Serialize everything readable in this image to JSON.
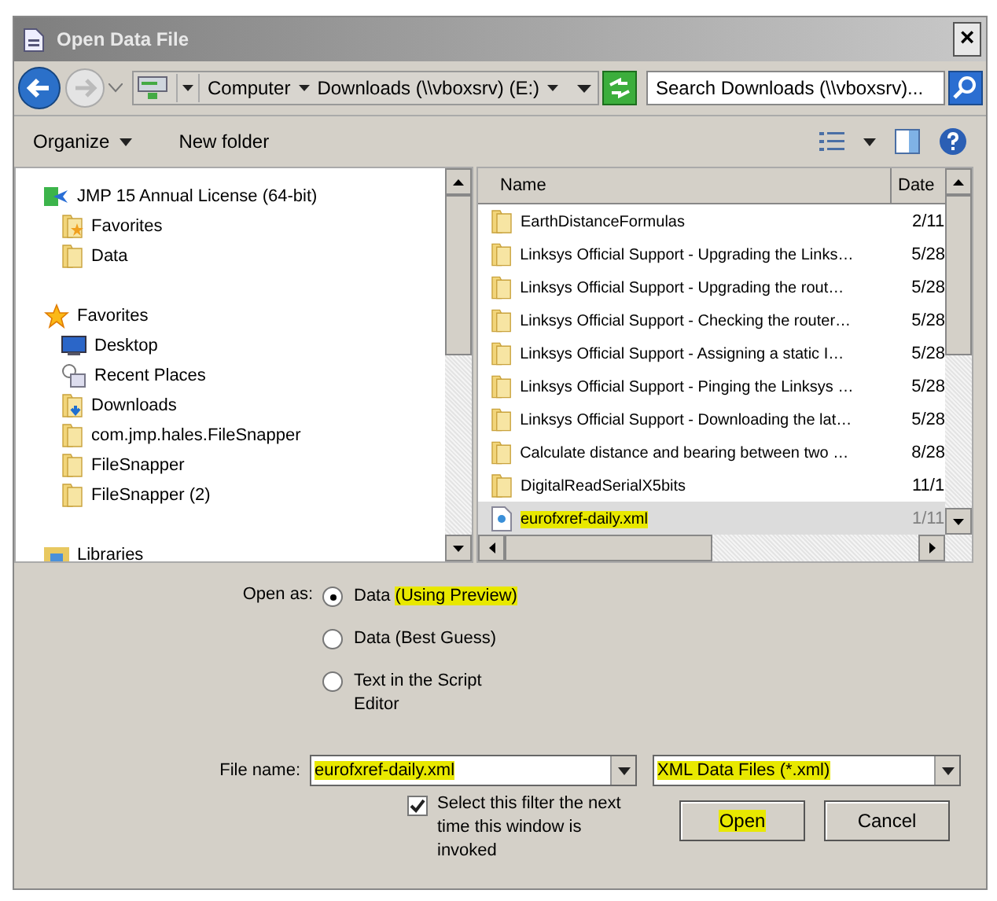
{
  "window": {
    "title": "Open Data File",
    "close": "×"
  },
  "address": {
    "crumbs": [
      "Computer",
      "Downloads (\\\\vboxsrv) (E:)"
    ]
  },
  "search": {
    "placeholder": "Search Downloads (\\\\vboxsrv)..."
  },
  "toolbar": {
    "organize": "Organize",
    "new_folder": "New folder"
  },
  "sidebar": {
    "items": [
      {
        "label": "JMP 15 Annual License (64-bit)",
        "kind": "app",
        "children": [
          {
            "label": "Favorites",
            "kind": "starfolder"
          },
          {
            "label": "Data",
            "kind": "folder"
          }
        ]
      },
      {
        "label": "Favorites",
        "kind": "star",
        "children": [
          {
            "label": "Desktop",
            "kind": "desktop"
          },
          {
            "label": "Recent Places",
            "kind": "recent"
          },
          {
            "label": "Downloads",
            "kind": "downloads"
          },
          {
            "label": "com.jmp.hales.FileSnapper",
            "kind": "folder"
          },
          {
            "label": "FileSnapper",
            "kind": "folder"
          },
          {
            "label": "FileSnapper (2)",
            "kind": "folder"
          }
        ]
      },
      {
        "label": "Libraries",
        "kind": "library"
      }
    ]
  },
  "table": {
    "columns": [
      "Name",
      "Date"
    ],
    "rows": [
      {
        "name": "EarthDistanceFormulas",
        "date": "2/11",
        "kind": "folder",
        "selected": false,
        "highlighted": false
      },
      {
        "name": "Linksys Official Support - Upgrading the Links…",
        "date": "5/28",
        "kind": "folder",
        "selected": false,
        "highlighted": false
      },
      {
        "name": "Linksys Official Support - Upgrading the rout…",
        "date": "5/28",
        "kind": "folder",
        "selected": false,
        "highlighted": false
      },
      {
        "name": "Linksys Official Support - Checking the router…",
        "date": "5/28",
        "kind": "folder",
        "selected": false,
        "highlighted": false
      },
      {
        "name": "Linksys Official Support - Assigning a static I…",
        "date": "5/28",
        "kind": "folder",
        "selected": false,
        "highlighted": false
      },
      {
        "name": "Linksys Official Support - Pinging the Linksys …",
        "date": "5/28",
        "kind": "folder",
        "selected": false,
        "highlighted": false
      },
      {
        "name": "Linksys Official Support - Downloading the lat…",
        "date": "5/28",
        "kind": "folder",
        "selected": false,
        "highlighted": false
      },
      {
        "name": "Calculate distance and bearing between two …",
        "date": "8/28",
        "kind": "folder",
        "selected": false,
        "highlighted": false
      },
      {
        "name": "DigitalReadSerialX5bits",
        "date": "11/1",
        "kind": "folder",
        "selected": false,
        "highlighted": false
      },
      {
        "name": "eurofxref-daily.xml",
        "date": "1/11",
        "kind": "xml",
        "selected": true,
        "highlighted": true
      }
    ]
  },
  "open_as": {
    "label": "Open as:",
    "options": [
      {
        "label": "Data",
        "note": "(Using Preview)",
        "selected": true,
        "highlighted": true
      },
      {
        "label": "Data (Best Guess)",
        "selected": false,
        "highlighted": false
      },
      {
        "label": "Text in the Script Editor",
        "selected": false,
        "highlighted": false
      }
    ]
  },
  "file_name": {
    "label": "File name:",
    "value": "eurofxref-daily.xml",
    "highlighted": true
  },
  "filter": {
    "value": "XML Data Files (*.xml)",
    "highlighted": true
  },
  "remember_filter": {
    "label": "Select this filter the next time this window is invoked",
    "checked": true
  },
  "buttons": [
    {
      "label": "Open",
      "highlighted": true
    },
    {
      "label": "Cancel",
      "highlighted": false
    }
  ]
}
